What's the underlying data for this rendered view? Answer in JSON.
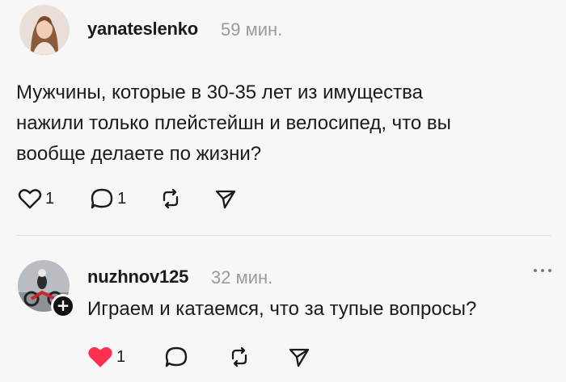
{
  "post": {
    "username": "yanateslenko",
    "time": "59 мин.",
    "text_lines": [
      "Мужчины, которые в 30-35 лет из имущества",
      "нажили только плейстейшн и велосипед, что вы",
      "вообще делаете по жизни?"
    ],
    "likes": "1",
    "comments": "1"
  },
  "reply": {
    "username": "nuzhnov125",
    "time": "32 мин.",
    "text": "Играем и катаемся, что за тупые вопросы?",
    "likes": "1",
    "follow_symbol": "+"
  },
  "icons": {
    "like": "heart-icon",
    "liked": "heart-filled-icon",
    "comment": "comment-bubble-icon",
    "repost": "repost-icon",
    "share": "send-icon",
    "more": "more-dots-icon"
  },
  "colors": {
    "liked_red": "#ff2f4f",
    "time_gray": "#9a9a9a"
  }
}
